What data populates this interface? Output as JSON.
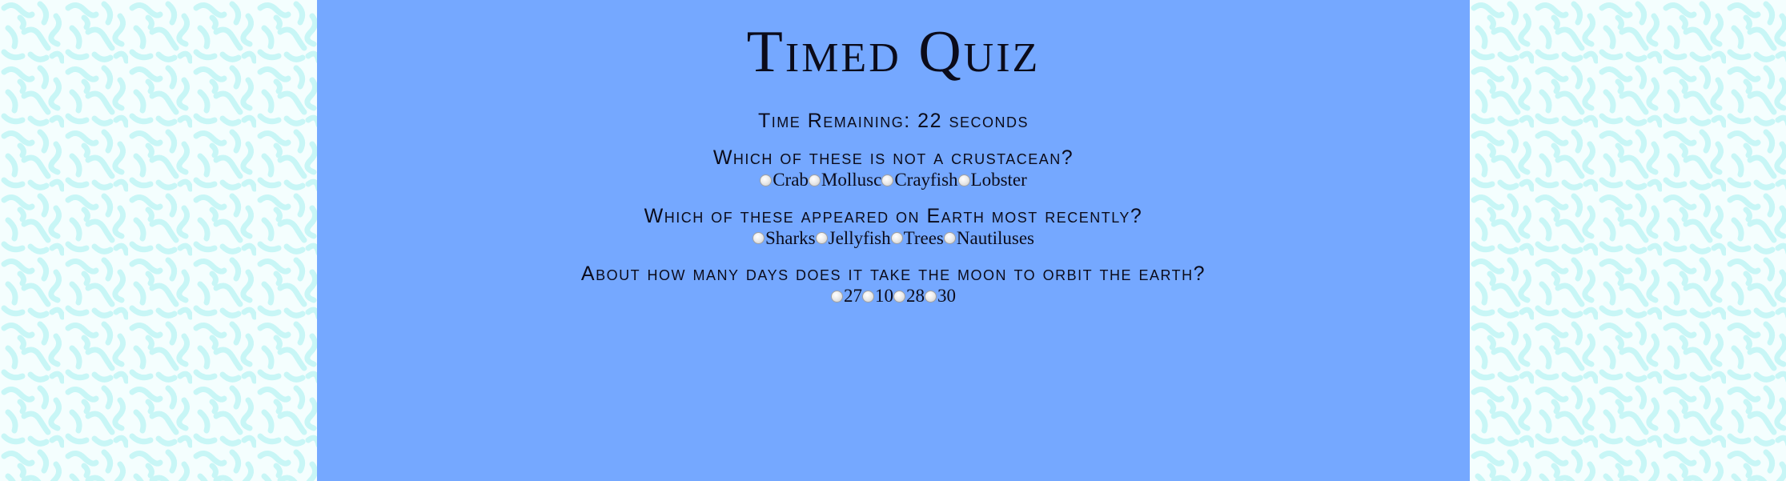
{
  "title": "Timed Quiz",
  "timer": "Time Remaining: 22 seconds",
  "questions": [
    {
      "text": "Which of these is not a crustacean?",
      "options": [
        "Crab",
        "Mollusc",
        "Crayfish",
        "Lobster"
      ]
    },
    {
      "text": "Which of these appeared on Earth most recently?",
      "options": [
        "Sharks",
        "Jellyfish",
        "Trees",
        "Nautiluses"
      ]
    },
    {
      "text": "About how many days does it take the moon to orbit the earth?",
      "options": [
        "27",
        "10",
        "28",
        "30"
      ]
    }
  ],
  "colors": {
    "main_background": "#75a8ff",
    "pattern": "#c8f6f6",
    "pattern_background": "#f4fefe",
    "text": "#0b0b1a"
  }
}
